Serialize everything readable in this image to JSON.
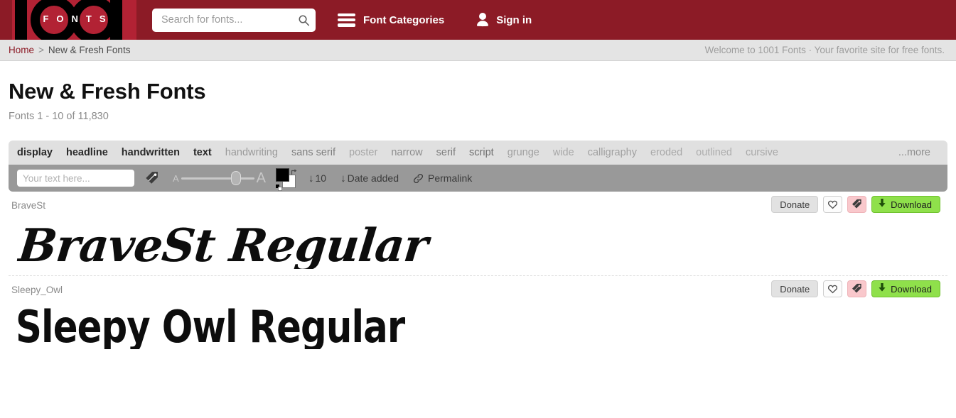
{
  "header": {
    "logo_text": "FONTS",
    "logo_alt": "1001 Fonts logo",
    "search_placeholder": "Search for fonts...",
    "search_value": "",
    "categories_label": "Font Categories",
    "signin_label": "Sign in",
    "bg_color": "#8c1b26",
    "logo_panel_color": "#b22234"
  },
  "breadcrumb": {
    "home": "Home",
    "separator": ">",
    "current": "New & Fresh Fonts",
    "welcome": "Welcome to 1001 Fonts · Your favorite site for free fonts."
  },
  "page": {
    "title": "New & Fresh Fonts",
    "subtitle": "Fonts 1 - 10 of 11,830"
  },
  "tags": [
    {
      "label": "display",
      "color": "#2a2a2a",
      "weight": "bold"
    },
    {
      "label": "headline",
      "color": "#2a2a2a",
      "weight": "bold"
    },
    {
      "label": "handwritten",
      "color": "#2a2a2a",
      "weight": "bold"
    },
    {
      "label": "text",
      "color": "#2a2a2a",
      "weight": "bold"
    },
    {
      "label": "handwriting",
      "color": "#9a9a9a",
      "weight": "normal"
    },
    {
      "label": "sans serif",
      "color": "#7e7e7e",
      "weight": "normal"
    },
    {
      "label": "poster",
      "color": "#a5a5a5",
      "weight": "normal"
    },
    {
      "label": "narrow",
      "color": "#8d8d8d",
      "weight": "normal"
    },
    {
      "label": "serif",
      "color": "#7e7e7e",
      "weight": "normal"
    },
    {
      "label": "script",
      "color": "#6f6f6f",
      "weight": "normal"
    },
    {
      "label": "grunge",
      "color": "#a0a0a0",
      "weight": "normal"
    },
    {
      "label": "wide",
      "color": "#a8a8a8",
      "weight": "normal"
    },
    {
      "label": "calligraphy",
      "color": "#a0a0a0",
      "weight": "normal"
    },
    {
      "label": "eroded",
      "color": "#a8a8a8",
      "weight": "normal"
    },
    {
      "label": "outlined",
      "color": "#adadad",
      "weight": "normal"
    },
    {
      "label": "cursive",
      "color": "#a8a8a8",
      "weight": "normal"
    }
  ],
  "tags_more": "...more",
  "toolbar": {
    "text_placeholder": "Your text here...",
    "text_value": "",
    "size_slider_percent": 68,
    "size_small_label": "A",
    "size_large_label": "A",
    "foreground_color": "#000000",
    "background_color": "#ffffff",
    "count_label": "10",
    "count_arrow": "↓",
    "sort_label": "Date added",
    "sort_arrow": "↓",
    "permalink_label": "Permalink"
  },
  "actions": {
    "donate_label": "Donate",
    "download_label": "Download",
    "favorite_icon": "heart-icon",
    "tag_icon": "tag-icon"
  },
  "fonts": [
    {
      "name": "BraveSt",
      "preview_text": "BraveSt Regular"
    },
    {
      "name": "Sleepy_Owl",
      "preview_text": "Sleepy Owl Regular"
    }
  ]
}
